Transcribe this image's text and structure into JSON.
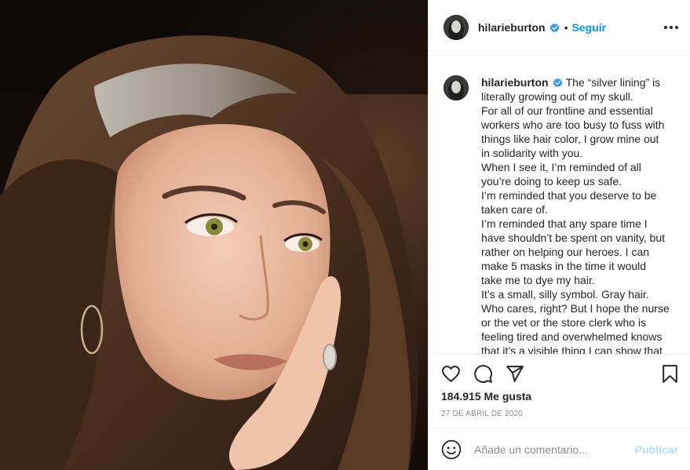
{
  "post": {
    "username": "hilarieburton",
    "verified": true,
    "follow_label": "Seguir",
    "separator": "•"
  },
  "caption": {
    "username": "hilarieburton",
    "lines": [
      "The “silver lining” is",
      "literally growing out of my skull.",
      "For all of our frontline and essential",
      "workers who are too busy to fuss with",
      "things like hair color, I grow mine out",
      "in solidarity with you.",
      "When I see it, I’m reminded of all",
      "you’re doing to keep us safe.",
      "I’m reminded that you deserve to be",
      "taken care of.",
      "I’m reminded that any spare time I",
      "have shouldn’t be spent on vanity, but",
      "rather on helping our heroes. I can",
      "make 5 masks in the time it would",
      "take me to dye my hair.",
      "It’s a small, silly symbol. Gray hair.",
      "Who cares, right? But I hope the nurse",
      "or the vet or the store clerk who is",
      "feeling tired and overwhelmed knows",
      "that it’s a visible thing I can show that"
    ]
  },
  "actions": {
    "icons": [
      "heart-icon",
      "comment-icon",
      "share-icon",
      "bookmark-icon"
    ]
  },
  "likes": "184.915 Me gusta",
  "date": "27 DE ABRIL DE 2020",
  "comment": {
    "placeholder": "Añade un comentario...",
    "publish_label": "Publicar"
  },
  "colors": {
    "accent": "#0095f6",
    "publish_disabled": "#b2dffc",
    "text": "#262626",
    "muted": "#8e8e8e"
  }
}
